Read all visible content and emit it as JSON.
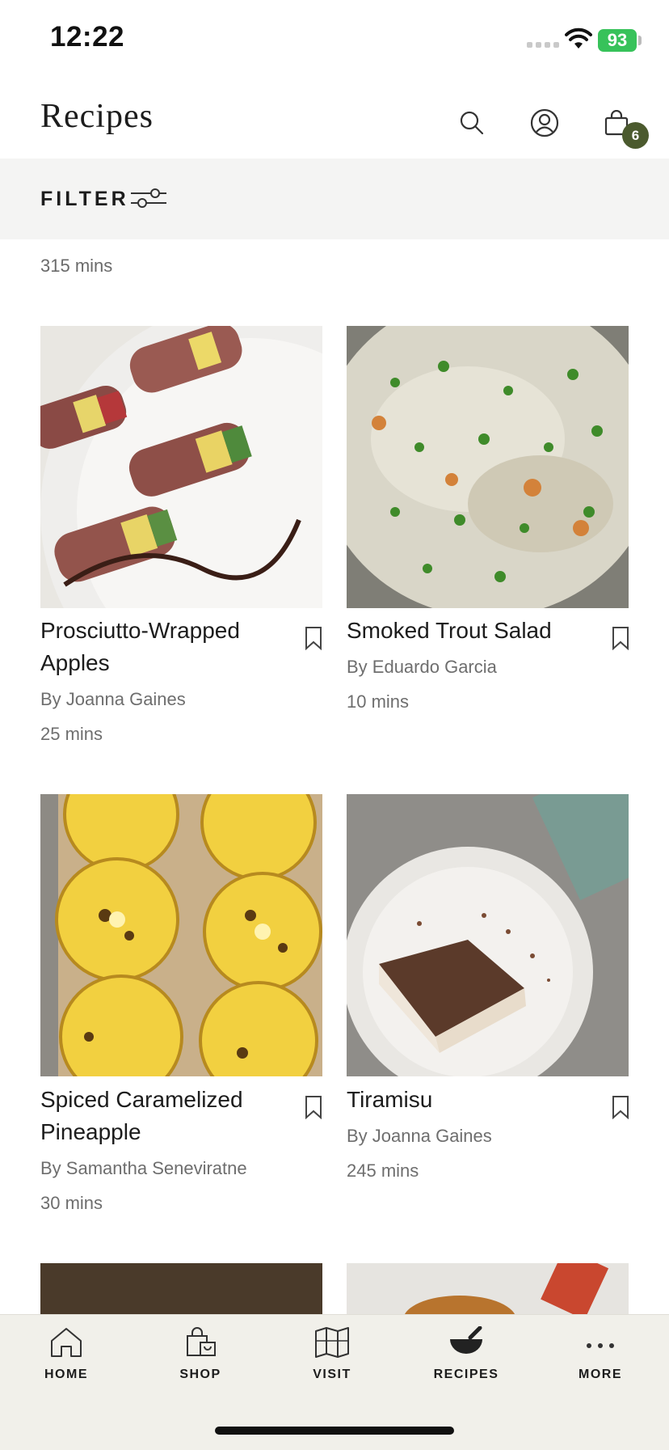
{
  "status": {
    "time": "12:22",
    "battery": "93"
  },
  "header": {
    "title": "Recipes",
    "cart_count": "6"
  },
  "filter": {
    "label": "FILTER"
  },
  "partial_row": {
    "time": "315 mins"
  },
  "recipes": [
    {
      "title": "Prosciutto-Wrapped Apples",
      "author": "By Joanna Gaines",
      "time": "25 mins"
    },
    {
      "title": "Smoked Trout Salad",
      "author": "By Eduardo Garcia",
      "time": "10 mins"
    },
    {
      "title": "Spiced Caramelized Pineapple",
      "author": "By Samantha Seneviratne",
      "time": "30 mins"
    },
    {
      "title": "Tiramisu",
      "author": "By Joanna Gaines",
      "time": "245 mins"
    }
  ],
  "tabs": [
    {
      "label": "HOME",
      "icon": "home-icon"
    },
    {
      "label": "SHOP",
      "icon": "shopping-bag-icon"
    },
    {
      "label": "VISIT",
      "icon": "map-icon"
    },
    {
      "label": "RECIPES",
      "icon": "mortar-bowl-icon"
    },
    {
      "label": "MORE",
      "icon": "more-dots-icon"
    }
  ],
  "colors": {
    "accent": "#4b5a2e",
    "tabbar": "#f1f0ea",
    "filterbar": "#f4f4f3"
  }
}
